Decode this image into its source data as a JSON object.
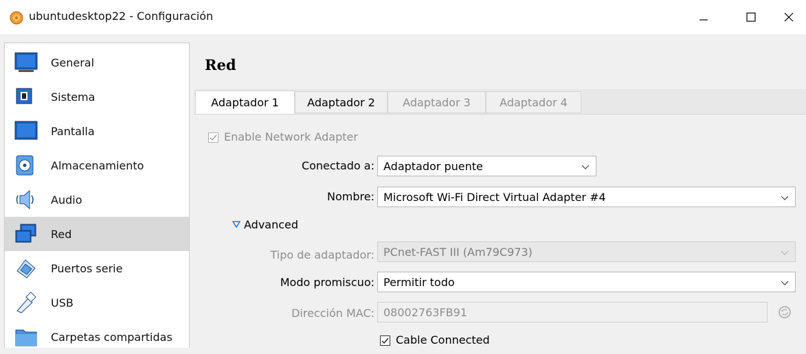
{
  "window": {
    "title": "ubuntudesktop22 - Configuración",
    "icon": "virtualbox-app-icon",
    "controls": [
      "minimize-icon",
      "maximize-icon",
      "close-icon"
    ]
  },
  "sidebar": {
    "items": [
      {
        "label": "General",
        "icon": "general-monitor-icon",
        "selected": false
      },
      {
        "label": "Sistema",
        "icon": "chip-icon",
        "selected": false
      },
      {
        "label": "Pantalla",
        "icon": "display-icon",
        "selected": false
      },
      {
        "label": "Almacenamiento",
        "icon": "storage-disk-icon",
        "selected": false
      },
      {
        "label": "Audio",
        "icon": "speaker-icon",
        "selected": false
      },
      {
        "label": "Red",
        "icon": "network-icon",
        "selected": true
      },
      {
        "label": "Puertos serie",
        "icon": "serial-port-icon",
        "selected": false
      },
      {
        "label": "USB",
        "icon": "usb-icon",
        "selected": false
      },
      {
        "label": "Carpetas compartidas",
        "icon": "shared-folder-icon",
        "selected": false
      }
    ]
  },
  "main": {
    "title": "Red",
    "tabs": [
      {
        "label": "Adaptador 1",
        "state": "active"
      },
      {
        "label": "Adaptador 2",
        "state": "enabled"
      },
      {
        "label": "Adaptador 3",
        "state": "disabled"
      },
      {
        "label": "Adaptador 4",
        "state": "disabled"
      }
    ],
    "enable_adapter": {
      "label": "Enable Network Adapter",
      "checked": true,
      "disabled": true
    },
    "attached_to": {
      "label": "Conectado a:",
      "value": "Adaptador puente"
    },
    "name": {
      "label": "Nombre:",
      "value": "Microsoft Wi-Fi Direct Virtual Adapter #4"
    },
    "advanced": {
      "label": "Advanced",
      "expanded": true
    },
    "adapter_type": {
      "label": "Tipo de adaptador:",
      "value": "PCnet-FAST III (Am79C973)",
      "disabled": true
    },
    "promiscuous": {
      "label": "Modo promiscuo:",
      "value": "Permitir todo"
    },
    "mac": {
      "label": "Dirección MAC:",
      "value": "08002763FB91",
      "disabled": true
    },
    "cable": {
      "label": "Cable Connected",
      "checked": true
    }
  },
  "colors": {
    "selected_bg": "#d9d9d9",
    "disabled_text": "#8d8d8d",
    "advanced_arrow": "#2b7cd3"
  }
}
